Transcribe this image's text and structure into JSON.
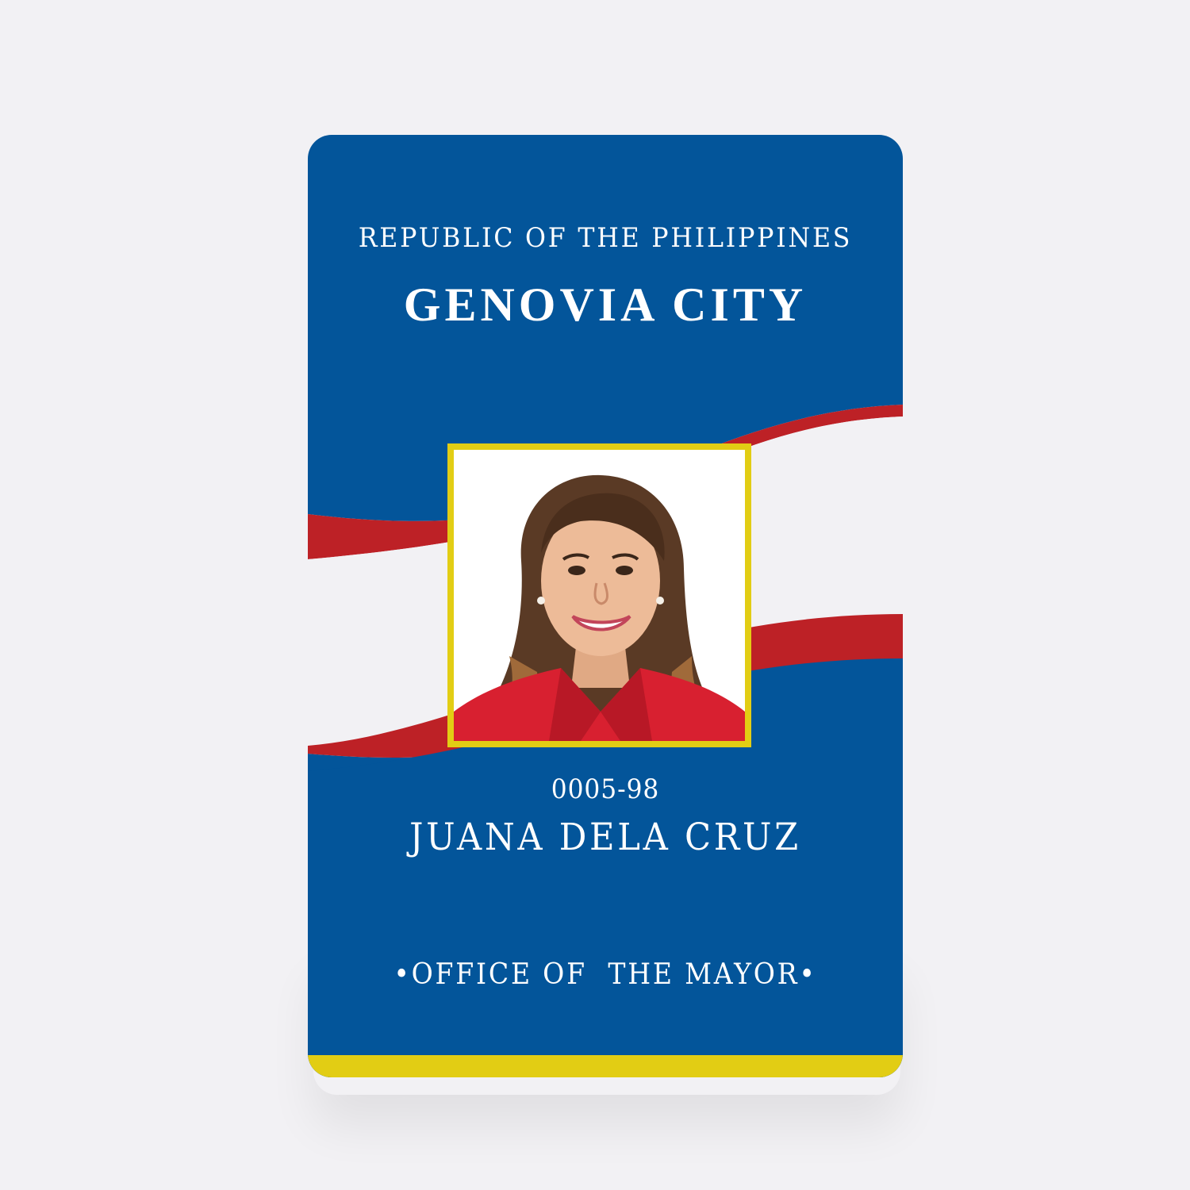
{
  "card": {
    "country": "REPUBLIC OF THE PHILIPPINES",
    "city": "GENOVIA CITY",
    "id_number": "0005-98",
    "holder_name": "JUANA DELA CRUZ",
    "office": "•OFFICE OF  THE MAYOR•",
    "photo": "id-photo"
  },
  "colors": {
    "card_blue": "#03559a",
    "wave_red": "#bd2126",
    "background_white": "#f2f1f4",
    "accent_yellow": "#e2cd14",
    "text_white": "#ffffff"
  }
}
